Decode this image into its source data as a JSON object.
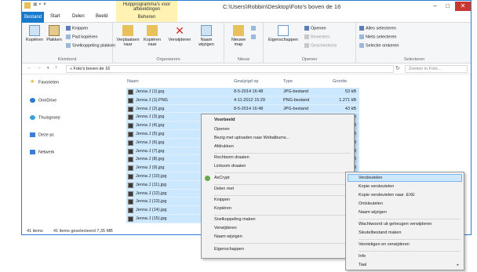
{
  "window": {
    "title": "C:\\Users\\Robbin\\Desktop\\Foto's boven de 16",
    "context_tab_title": "Hulpprogramma's voor afbeeldingen",
    "context_tab_sub": "Beheren",
    "minimize": "–",
    "maximize": "□",
    "close": "✕"
  },
  "tabs": [
    "Bestand",
    "Start",
    "Delen",
    "Beeld"
  ],
  "ribbon": {
    "groups": [
      {
        "label": "Klembord"
      },
      {
        "label": "Organiseren"
      },
      {
        "label": "Nieuw"
      },
      {
        "label": "Openen"
      },
      {
        "label": "Selecteren"
      }
    ],
    "clipboard": {
      "copy": "Kopiëren",
      "paste": "Plakken",
      "cut": "Knippen",
      "copy_path": "Pad kopiëren",
      "paste_shortcut": "Snelkoppeling plakken"
    },
    "organize": {
      "move": "Verplaatsen naar",
      "copy_to": "Kopiëren naar",
      "delete": "Verwijderen",
      "rename": "Naam wijzigen"
    },
    "new": {
      "new_folder": "Nieuwe map"
    },
    "open": {
      "properties": "Eigenschappen",
      "open": "Openen",
      "edit": "Bewerken",
      "history": "Geschiedenis"
    },
    "select": {
      "select_all": "Alles selecteren",
      "select_none": "Niets selecteren",
      "invert": "Selectie omkeren"
    }
  },
  "address": {
    "path": "« Foto's boven de 16",
    "search_placeholder": "Zoeken in Foto..."
  },
  "nav": {
    "items": [
      "Favorieten",
      "OneDrive",
      "Thuisgroep",
      "Deze pc",
      "Netwerk"
    ]
  },
  "columns": {
    "name": "Naam",
    "date": "Gewijzigd op",
    "type": "Type",
    "size": "Grootte"
  },
  "files": [
    {
      "name": "Jenna J (1).jpg",
      "date": "8-5-2014 16:48",
      "type": "JPG-bestand",
      "size": "53 kB"
    },
    {
      "name": "Jenna J (1).PNG",
      "date": "4-11-2012 15:29",
      "type": "PNG-bestand",
      "size": "1.271 kB"
    },
    {
      "name": "Jenna J (2).jpg",
      "date": "8-5-2014 16:48",
      "type": "JPG-bestand",
      "size": "43 kB"
    },
    {
      "name": "Jenna J (3).jpg",
      "date": "",
      "type": "",
      "size": "36 kB"
    },
    {
      "name": "Jenna J (4).jpg",
      "date": "",
      "type": "",
      "size": "48 kB"
    },
    {
      "name": "Jenna J (5).jpg",
      "date": "",
      "type": "",
      "size": "76 kB"
    },
    {
      "name": "Jenna J (6).jpg",
      "date": "",
      "type": "",
      "size": "54 kB"
    },
    {
      "name": "Jenna J (7).jpg",
      "date": "",
      "type": "",
      "size": "60 kB"
    },
    {
      "name": "Jenna J (8).jpg",
      "date": "",
      "type": "",
      "size": "59 kB"
    },
    {
      "name": "Jenna J (9).jpg",
      "date": "",
      "type": "",
      "size": "65 kB"
    },
    {
      "name": "Jenna J (10).jpg",
      "date": "",
      "type": "",
      "size": "50 kB"
    },
    {
      "name": "Jenna J (11).jpg",
      "date": "",
      "type": "",
      "size": "48 kB"
    },
    {
      "name": "Jenna J (12).jpg",
      "date": "",
      "type": "",
      "size": ""
    },
    {
      "name": "Jenna J (13).jpg",
      "date": "",
      "type": "",
      "size": ""
    },
    {
      "name": "Jenna J (14).jpg",
      "date": "",
      "type": "",
      "size": ""
    },
    {
      "name": "Jenna J (15).jpg",
      "date": "",
      "type": "",
      "size": ""
    }
  ],
  "status": {
    "count": "41 items",
    "selected": "41 items geselecteerd  7,35 MB"
  },
  "context_menu": {
    "items": [
      "Voorbeeld",
      "Openen",
      "Bezig met uploaden naar Webalbums...",
      "Afdrukken",
      "Rechtsom draaien",
      "Linksom draaien",
      "AxCrypt",
      "Delen met",
      "Knippen",
      "Kopiëren",
      "Snelkoppeling maken",
      "Verwijderen",
      "Naam wijzigen",
      "Eigenschappen"
    ]
  },
  "submenu": {
    "items": [
      "Versleutelen",
      "Kopie versleutelen",
      "Kopie versleutelen naar .EXE",
      "Ontsleutelen",
      "Naam wijzigen",
      "Wachtwoord uit geheugen verwijderen",
      "Sleutelbestand maken",
      "Vernietigen en verwijderen",
      "Info",
      "Taal"
    ]
  },
  "colors": {
    "accent": "#1979ca",
    "selection": "#cce8ff",
    "context_tab": "#fff2b3",
    "close": "#c7392e"
  }
}
